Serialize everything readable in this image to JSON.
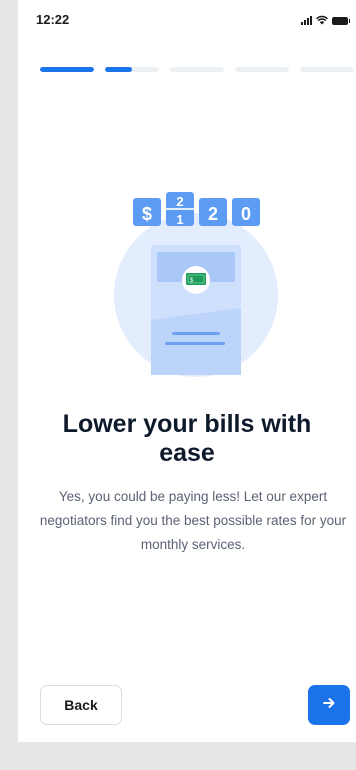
{
  "status_bar": {
    "time": "12:22"
  },
  "progress": {
    "total_steps": 5,
    "completed_steps": 1,
    "current_step_progress": 0.5
  },
  "illustration": {
    "digits": [
      "$",
      "1",
      "2",
      "0"
    ],
    "flip_digit_top": "2",
    "money_label": "$"
  },
  "onboarding": {
    "title": "Lower your bills with ease",
    "description": "Yes, you could be paying less! Let our expert negotiators find you the best possible rates for your monthly services."
  },
  "footer": {
    "back_label": "Back",
    "next_icon": "arrow-right-icon"
  },
  "colors": {
    "accent": "#1a73e8",
    "illustration_light": "#e3edfd",
    "illustration_mid": "#b9d2fb",
    "money_green": "#1e9b5a"
  }
}
